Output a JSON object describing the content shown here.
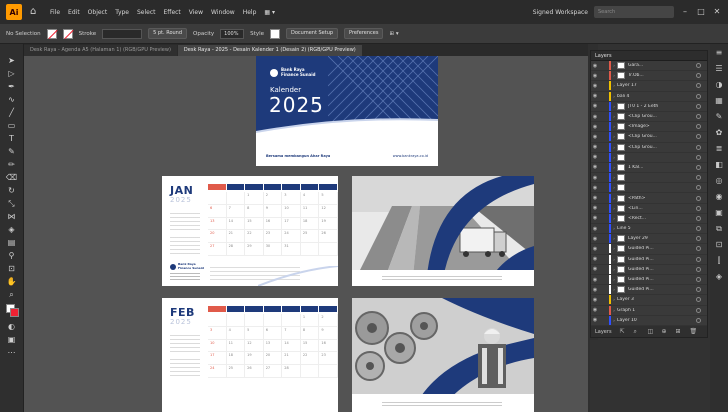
{
  "menubar": {
    "app_logo": "Ai",
    "items": [
      "File",
      "Edit",
      "Object",
      "Type",
      "Select",
      "Effect",
      "View",
      "Window",
      "Help"
    ],
    "workspace_label": "Signed Workspace",
    "search_placeholder": "Search",
    "layout_icon": "grid-icon"
  },
  "controlbar": {
    "selection_label": "No Selection",
    "stroke_label": "Stroke",
    "style_label": "5 pt. Round",
    "opacity_label": "Opacity",
    "opacity_value": "100%",
    "style_field": "Style",
    "doc_setup_label": "Document Setup",
    "preferences_label": "Preferences"
  },
  "tabs": [
    {
      "label": "Desk Raya - Agenda A5 (Halaman 1) (RGB/GPU Preview)",
      "active": false
    },
    {
      "label": "Desk Raya - 2025 - Desain Kalender 1 (Desain 2) (RGB/GPU Preview)",
      "active": true
    }
  ],
  "cover": {
    "company_line1": "Bank Raya",
    "company_line2": "Finance Sunaid",
    "kalender": "Kalender",
    "year": "2025",
    "footer_left": "Bersama membangun Ahar Raya",
    "footer_right": "www.bankraya.co.id",
    "brand_color": "#1e3a7b"
  },
  "calendar_pages": [
    {
      "month": "JAN",
      "year": "2025",
      "days": [
        "",
        "",
        "1",
        "2",
        "3",
        "4",
        "5",
        "6",
        "7",
        "8",
        "9",
        "10",
        "11",
        "12",
        "13",
        "14",
        "15",
        "16",
        "17",
        "18",
        "19",
        "20",
        "21",
        "22",
        "23",
        "24",
        "25",
        "26",
        "27",
        "28",
        "29",
        "30",
        "31",
        "",
        ""
      ]
    },
    {
      "month": "FEB",
      "year": "2025",
      "days": [
        "",
        "",
        "",
        "",
        "",
        "1",
        "2",
        "3",
        "4",
        "5",
        "6",
        "7",
        "8",
        "9",
        "10",
        "11",
        "12",
        "13",
        "14",
        "15",
        "16",
        "17",
        "18",
        "19",
        "20",
        "21",
        "22",
        "23",
        "24",
        "25",
        "26",
        "27",
        "28",
        "",
        ""
      ]
    }
  ],
  "layers_panel": {
    "tab_label": "Layers",
    "rows": [
      {
        "name": "Gara...",
        "color": "#e05a4a",
        "thumb": true
      },
      {
        "name": "Tr.Ob...",
        "color": "#e05a4a",
        "thumb": true
      },
      {
        "name": "Layer 17",
        "color": "#f0c000",
        "thumb": false
      },
      {
        "name": "bali 4",
        "color": "#f0c000",
        "thumb": false
      },
      {
        "name": "JT0 1 - 2 Eeth",
        "color": "#3050ff",
        "thumb": true
      },
      {
        "name": "<Clip Grou...",
        "color": "#3050ff",
        "thumb": true
      },
      {
        "name": "<Image>",
        "color": "#3050ff",
        "thumb": true
      },
      {
        "name": "<Clip Grou...",
        "color": "#3050ff",
        "thumb": true
      },
      {
        "name": "<Clip Grou...",
        "color": "#3050ff",
        "thumb": true
      },
      {
        "name": "",
        "color": "#3050ff",
        "thumb": true
      },
      {
        "name": "1 Kal...",
        "color": "#3050ff",
        "thumb": true
      },
      {
        "name": "",
        "color": "#3050ff",
        "thumb": true
      },
      {
        "name": "",
        "color": "#3050ff",
        "thumb": true
      },
      {
        "name": "<Path>",
        "color": "#3050ff",
        "thumb": true
      },
      {
        "name": "<Lin...",
        "color": "#3050ff",
        "thumb": true
      },
      {
        "name": "<Rect...",
        "color": "#3050ff",
        "thumb": true
      },
      {
        "name": "Line 5",
        "color": "#3050ff",
        "thumb": false
      },
      {
        "name": "Layer 29",
        "color": "#3050ff",
        "thumb": true
      },
      {
        "name": "Guided Pi...",
        "color": "#ffffff",
        "thumb": true
      },
      {
        "name": "Guided Pi...",
        "color": "#ffffff",
        "thumb": true
      },
      {
        "name": "Guided Pi...",
        "color": "#ffffff",
        "thumb": true
      },
      {
        "name": "Guided Pi...",
        "color": "#ffffff",
        "thumb": true
      },
      {
        "name": "Guided Pi...",
        "color": "#ffffff",
        "thumb": true
      },
      {
        "name": "Layer 3",
        "color": "#f0c000",
        "thumb": false
      },
      {
        "name": "Graph 1",
        "color": "#e05a4a",
        "thumb": false
      },
      {
        "name": "Layer 10",
        "color": "#3050ff",
        "thumb": false
      }
    ],
    "footer_label": "Layers"
  }
}
